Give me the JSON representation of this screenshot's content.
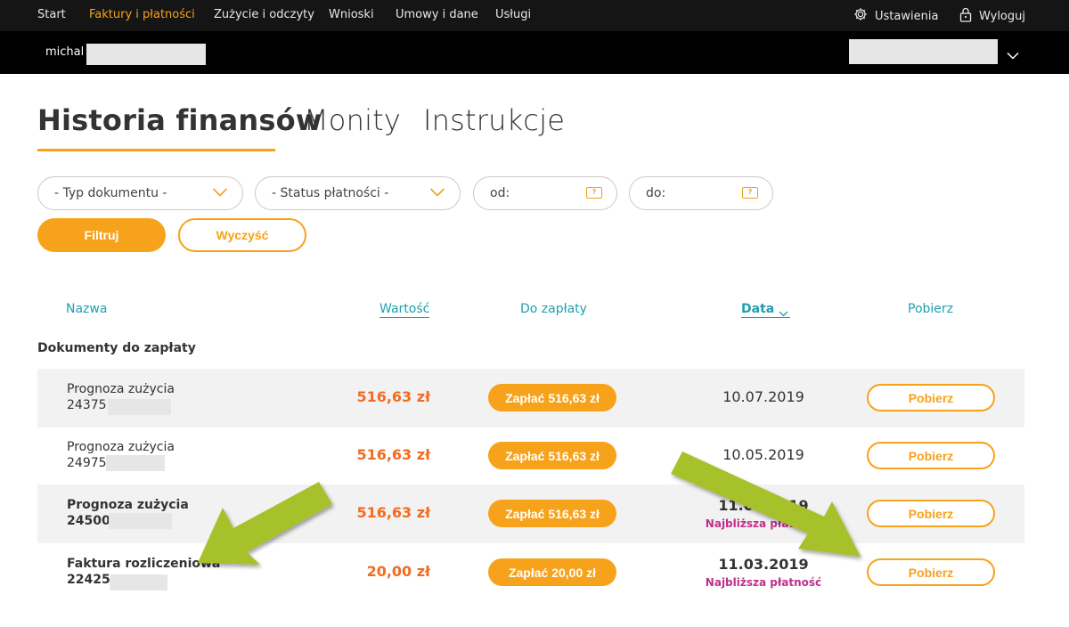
{
  "nav": {
    "items": [
      "Start",
      "Faktury i płatności",
      "Zużycie i odczyty",
      "Wnioski",
      "Umowy i dane",
      "Usługi"
    ],
    "settings_label": "Ustawienia",
    "logout_label": "Wyloguj"
  },
  "user": {
    "name": "michal"
  },
  "tabs": [
    "Historia finansów",
    "Monity",
    "Instrukcje"
  ],
  "filters": {
    "doc_type": "- Typ dokumentu -",
    "payment_status": "- Status płatności -",
    "from_label": "od:",
    "to_label": "do:",
    "filter_button": "Filtruj",
    "clear_button": "Wyczyść"
  },
  "table": {
    "headers": {
      "name": "Nazwa",
      "value": "Wartość",
      "to_pay": "Do zapłaty",
      "date": "Data",
      "download": "Pobierz"
    },
    "section_title": "Dokumenty do zapłaty",
    "rows": [
      {
        "name": "Prognoza zużycia",
        "number": "24375",
        "value": "516,63 zł",
        "pay": "Zapłać 516,63 zł",
        "date": "10.07.2019",
        "note": "",
        "download": "Pobierz"
      },
      {
        "name": "Prognoza zużycia",
        "number": "24975",
        "value": "516,63 zł",
        "pay": "Zapłać 516,63 zł",
        "date": "10.05.2019",
        "note": "",
        "download": "Pobierz"
      },
      {
        "name": "Prognoza zużycia",
        "number": "24500",
        "value": "516,63 zł",
        "pay": "Zapłać 516,63 zł",
        "date": "11.04.2019",
        "note": "Najbliższa płatność",
        "download": "Pobierz"
      },
      {
        "name": "Faktura rozliczeniowa",
        "number": "22425",
        "value": "20,00 zł",
        "pay": "Zapłać 20,00 zł",
        "date": "11.03.2019",
        "note": "Najbliższa płatność",
        "download": "Pobierz"
      }
    ]
  },
  "colors": {
    "accent": "#f7a21b",
    "value_orange": "#f26b21",
    "teal": "#1f9fad",
    "magenta": "#c0308a",
    "arrow_green": "#a6c12c"
  }
}
